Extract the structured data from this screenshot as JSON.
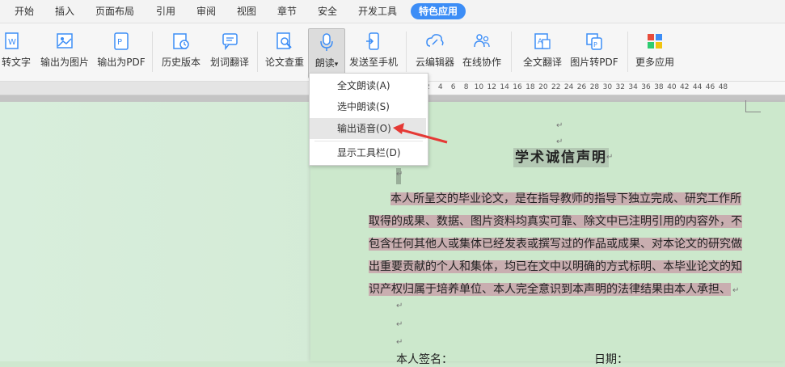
{
  "menu": {
    "tabs": [
      "开始",
      "插入",
      "页面布局",
      "引用",
      "审阅",
      "视图",
      "章节",
      "安全",
      "开发工具"
    ],
    "active_tab": "特色应用"
  },
  "ribbon": {
    "buttons": [
      "转文字",
      "输出为图片",
      "输出为PDF",
      "历史版本",
      "划词翻译",
      "论文查重",
      "朗读",
      "发送至手机",
      "云编辑器",
      "在线协作",
      "全文翻译",
      "图片转PDF",
      "更多应用"
    ],
    "read_aloud_arrow": "▾"
  },
  "ruler": {
    "ticks": [
      "2",
      "4",
      "6",
      "8",
      "10",
      "12",
      "14",
      "16",
      "18",
      "20",
      "22",
      "24",
      "26",
      "28",
      "30",
      "32",
      "34",
      "36",
      "38",
      "40",
      "42",
      "44",
      "46",
      "48"
    ]
  },
  "dropdown": {
    "items": [
      "全文朗读(A)",
      "选中朗读(S)",
      "输出语音(O)",
      "显示工具栏(D)"
    ]
  },
  "document": {
    "title": "学术诚信声明",
    "paragraph_lines": [
      "本人所呈交的毕业论文，是在指导教师的指导下独立完成、研究工作所",
      "取得的成果、数据、图片资料均真实可靠、除文中已注明引用的内容外，不",
      "包含任何其他人或集体已经发表或撰写过的作品或成果、对本论文的研究做",
      "出重要贡献的个人和集体，均已在文中以明确的方式标明、本毕业论文的知",
      "识产权归属于培养单位、本人完全意识到本声明的法律结果由本人承担、"
    ],
    "paragraph_mark": "↵",
    "signature_label": "本人签名：",
    "date_label": "日期："
  },
  "colors": {
    "accent": "#3c8df6",
    "selection_highlight": "#c9aeb0",
    "page_bg": "#cce8cc",
    "arrow": "#e53935"
  }
}
